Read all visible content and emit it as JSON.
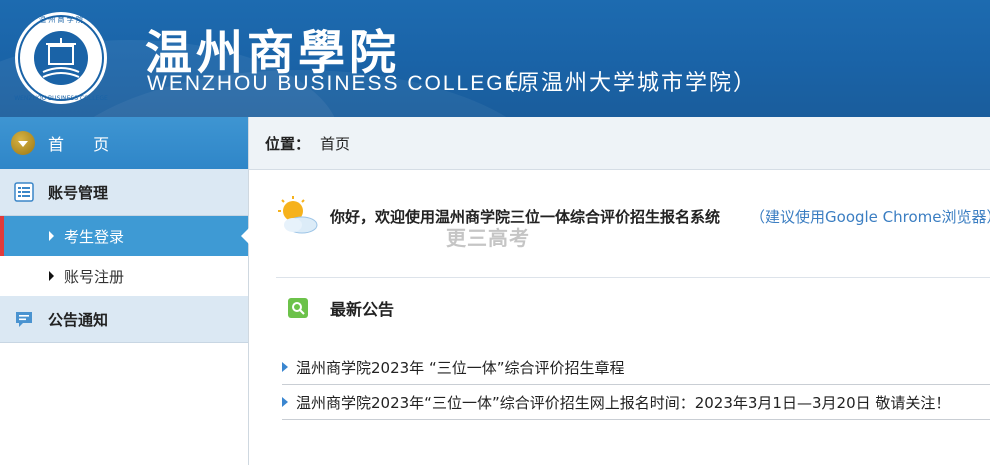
{
  "header": {
    "cn_title": "温州商學院",
    "en_title": "WENZHOU BUSINESS COLLEGE",
    "sub_title": "（原温州大学城市学院）",
    "logo_text": "WENZHOU BUSINESS COLLEGE"
  },
  "sidebar": {
    "home_label": "首 页",
    "groups": [
      {
        "label": "账号管理",
        "icon": "list-icon",
        "items": [
          {
            "label": "考生登录",
            "active": true
          },
          {
            "label": "账号注册",
            "active": false
          }
        ]
      },
      {
        "label": "公告通知",
        "icon": "chat-icon",
        "items": []
      }
    ]
  },
  "breadcrumb": {
    "label": "位置：",
    "value": "首页"
  },
  "welcome": {
    "text": "你好，欢迎使用温州商学院三位一体综合评价招生报名系统",
    "hint": "（建议使用Google Chrome浏览器）",
    "weather_icon": "sun-cloud-icon"
  },
  "watermark": "更三高考",
  "news": {
    "title": "最新公告",
    "items": [
      "温州商学院2023年 “三位一体”综合评价招生章程",
      "温州商学院2023年“三位一体”综合评价招生网上报名时间：2023年3月1日—3月20日 敬请关注！"
    ]
  },
  "colors": {
    "header_bg": "#1a63a7",
    "accent": "#3e9ad4",
    "active_marker": "#e03b3b",
    "link": "#3b7ec2"
  }
}
